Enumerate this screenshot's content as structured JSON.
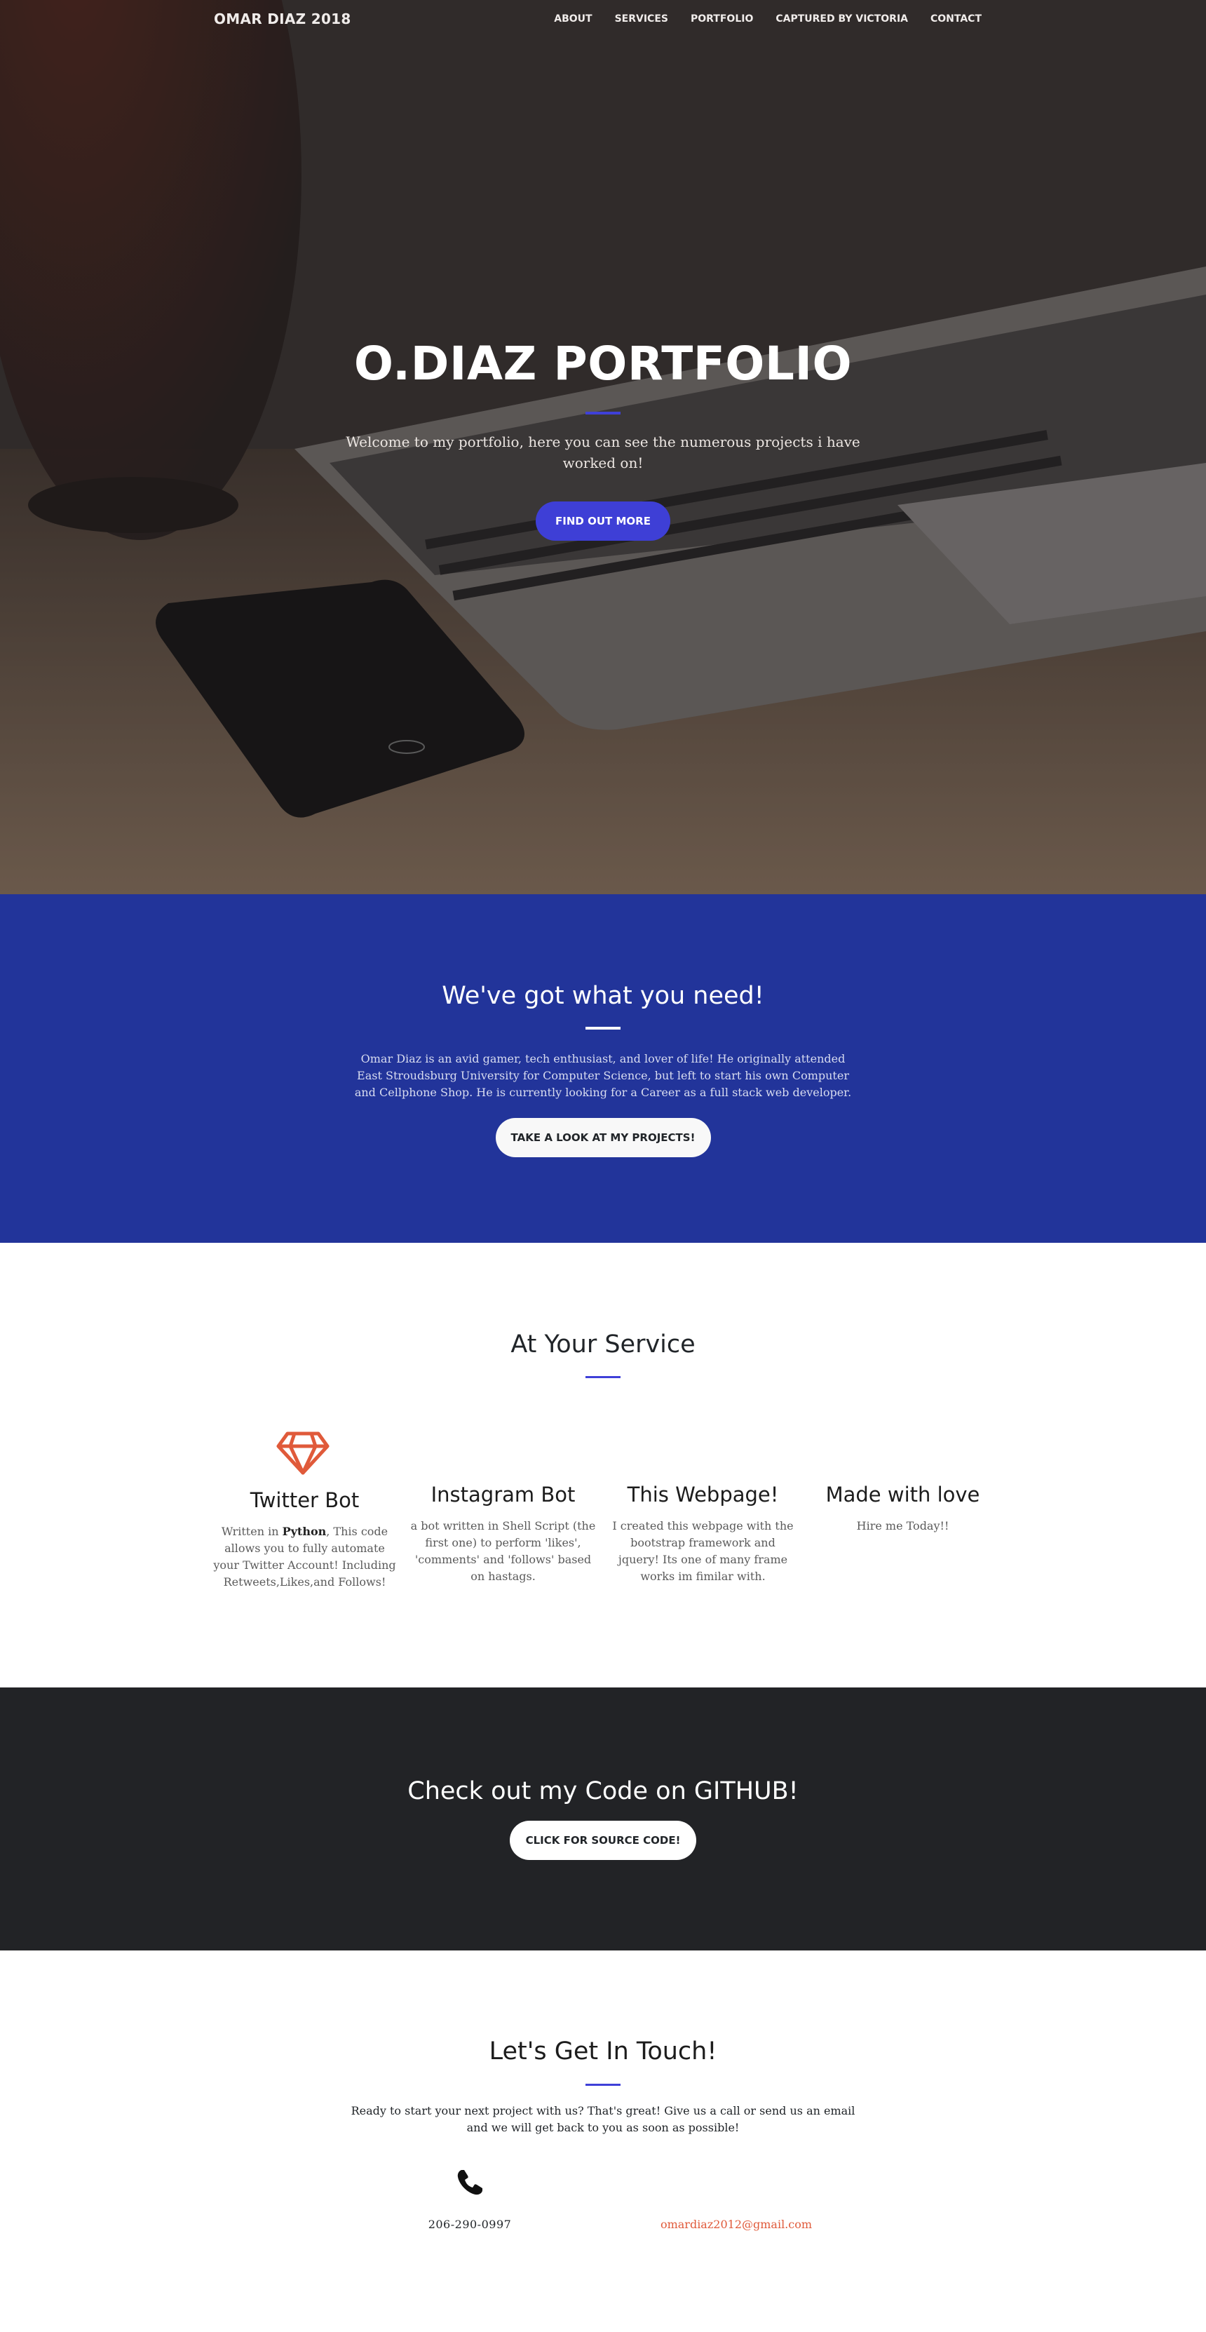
{
  "nav": {
    "brand": "OMAR DIAZ 2018",
    "links": [
      "ABOUT",
      "SERVICES",
      "PORTFOLIO",
      "CAPTURED BY VICTORIA",
      "CONTACT"
    ]
  },
  "hero": {
    "title": "O.DIAZ PORTFOLIO",
    "subtitle": "Welcome to my portfolio, here you can see the numerous projects i have worked on!",
    "button": "FIND OUT MORE"
  },
  "about": {
    "heading": "We've got what you need!",
    "text": "Omar Diaz is an avid gamer, tech enthusiast, and lover of life! He originally attended East Stroudsburg University for Computer Science, but left to start his own Computer and Cellphone Shop. He is currently looking for a Career as a full stack web developer.",
    "button": "TAKE A LOOK AT MY PROJECTS!"
  },
  "services": {
    "heading": "At Your Service",
    "items": [
      {
        "title": "Twitter Bot",
        "text_before": "Written in ",
        "text_bold": "Python",
        "text_after": ", This code allows you to fully automate your Twitter Account! Including Retweets,Likes,and Follows!",
        "icon": "gem-icon"
      },
      {
        "title": "Instagram Bot",
        "text": "a bot written in Shell Script (the first one) to perform 'likes', 'comments' and 'follows' based on hastags."
      },
      {
        "title": "This Webpage!",
        "text": "I created this webpage with the bootstrap framework and jquery! Its one of many frame works im fimilar with."
      },
      {
        "title": "Made with love",
        "text": "Hire me Today!!"
      }
    ]
  },
  "github": {
    "heading": "Check out my Code on GITHUB!",
    "button": "CLICK FOR SOURCE CODE!"
  },
  "contact": {
    "heading": "Let's Get In Touch!",
    "text": "Ready to start your next project with us? That's great! Give us a call or send us an email and we will get back to you as soon as possible!",
    "phone_icon": "phone-icon",
    "phone": "206-290-0997",
    "email": "omardiaz2012@gmail.com"
  },
  "colors": {
    "accent": "#3e3fd6",
    "about_bg": "#22349a",
    "github_bg": "#222326",
    "gem": "#e05a3a"
  }
}
